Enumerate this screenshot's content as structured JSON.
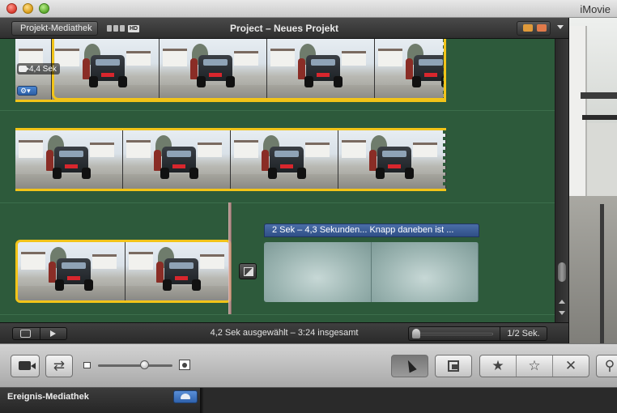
{
  "window": {
    "app_name": "iMovie"
  },
  "project_header": {
    "back_button_label": "Projekt-Mediathek",
    "hd_label": "HD",
    "title": "Project – Neues Projekt"
  },
  "clips": {
    "clip1_duration": "4,4 Sek"
  },
  "title_clip": {
    "banner": "2 Sek – 4,3 Sekunden... Knapp daneben ist ..."
  },
  "status_bar": {
    "summary": "4,2 Sek ausgewählt – 3:24 insgesamt",
    "zoom_label": "1/2 Sek."
  },
  "toolbar": {
    "rating_favorite_icon": "★",
    "rating_unmark_icon": "☆",
    "rating_reject_icon": "✕",
    "swap_icon": "⇄",
    "search_icon": "⚲",
    "gear_icon": "⚙▾"
  },
  "event_library": {
    "label": "Ereignis-Mediathek"
  }
}
